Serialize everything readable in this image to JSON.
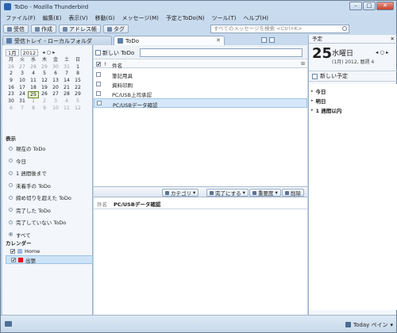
{
  "window": {
    "title": "ToDo - Mozilla Thunderbird",
    "controls": [
      "–",
      "□",
      "✕"
    ]
  },
  "menu": [
    "ファイル(F)",
    "編集(E)",
    "表示(V)",
    "移動(G)",
    "メッセージ(M)",
    "予定とToDo(N)",
    "ツール(T)",
    "ヘルプ(H)"
  ],
  "toolbar": {
    "receive": "受信",
    "compose": "作成",
    "addressbook": "アドレス帳",
    "tag": "タグ",
    "search_placeholder": "すべてのメッセージを検索 <Ctrl+K>"
  },
  "tabs": {
    "inbox": "受信トレイ - ローカルフォルダ",
    "todo": "ToDo"
  },
  "minical": {
    "month": "1月",
    "year": "2012",
    "nav": "◂ ○ ▸",
    "dow": [
      "月",
      "火",
      "水",
      "木",
      "金",
      "土",
      "日"
    ],
    "rows": [
      [
        "26",
        "27",
        "28",
        "29",
        "30",
        "31",
        "1"
      ],
      [
        "2",
        "3",
        "4",
        "5",
        "6",
        "7",
        "8"
      ],
      [
        "9",
        "10",
        "11",
        "12",
        "13",
        "14",
        "15"
      ],
      [
        "16",
        "17",
        "18",
        "19",
        "20",
        "21",
        "22"
      ],
      [
        "23",
        "24",
        "25",
        "26",
        "27",
        "28",
        "29"
      ],
      [
        "30",
        "31",
        "1",
        "2",
        "3",
        "4",
        "5"
      ],
      [
        "6",
        "7",
        "8",
        "9",
        "10",
        "11",
        "12"
      ]
    ],
    "today": "25"
  },
  "filters": {
    "heading": "表示",
    "items": [
      "現在の ToDo",
      "今日",
      "1 週間後まで",
      "未着手の ToDo",
      "締め切りを超えた ToDo",
      "完了した ToDo",
      "完了していない ToDo",
      "すべて"
    ],
    "selected_index": 7
  },
  "calendars": {
    "heading": "カレンダー",
    "items": [
      {
        "name": "Home",
        "color": "#9db9e0",
        "checked": true
      },
      {
        "name": "出張",
        "color": "#e01010",
        "checked": true
      }
    ]
  },
  "todo": {
    "new_button": "新しい ToDo",
    "col_title": "件名",
    "items": [
      "筆記用具",
      "資料印刷",
      "PC/USB上司承認",
      "PC/USBデータ確認"
    ],
    "selected_index": 3
  },
  "detail": {
    "category": "カテゴリ",
    "complete": "完了にする",
    "priority": "重要度",
    "delete": "削除",
    "name_label": "件名",
    "name_value": "PC/USBデータ確認"
  },
  "today_pane": {
    "header": "予定",
    "day_number": "25",
    "weekday": "水曜日",
    "sub": "(1月) 2012, 暦週 4",
    "nav": "◂ ○ ▸",
    "new_event": "新しい予定",
    "groups": [
      "今日",
      "明日",
      "1 週間以内"
    ]
  },
  "status": {
    "today_pane_toggle": "Today ペイン"
  }
}
